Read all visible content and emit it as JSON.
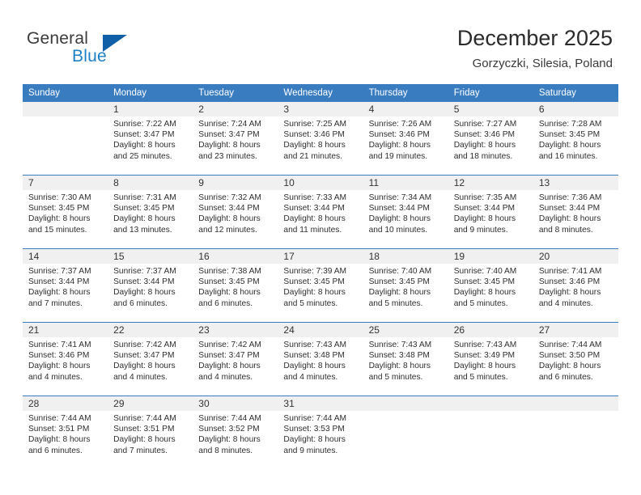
{
  "brand": {
    "name_part1": "General",
    "name_part2": "Blue",
    "triangle_icon": "triangle-icon",
    "accent_color": "#1060a8",
    "blue_text_color": "#1f7fc4"
  },
  "header": {
    "title": "December 2025",
    "subtitle": "Gorzyczki, Silesia, Poland",
    "header_bg_color": "#3a7cc0",
    "header_text_color": "#ffffff"
  },
  "weekday_headers": [
    "Sunday",
    "Monday",
    "Tuesday",
    "Wednesday",
    "Thursday",
    "Friday",
    "Saturday"
  ],
  "weeks": [
    [
      {
        "day": "",
        "sunrise": "",
        "sunset": "",
        "daylight_line1": "",
        "daylight_line2": ""
      },
      {
        "day": "1",
        "sunrise": "Sunrise: 7:22 AM",
        "sunset": "Sunset: 3:47 PM",
        "daylight_line1": "Daylight: 8 hours",
        "daylight_line2": "and 25 minutes."
      },
      {
        "day": "2",
        "sunrise": "Sunrise: 7:24 AM",
        "sunset": "Sunset: 3:47 PM",
        "daylight_line1": "Daylight: 8 hours",
        "daylight_line2": "and 23 minutes."
      },
      {
        "day": "3",
        "sunrise": "Sunrise: 7:25 AM",
        "sunset": "Sunset: 3:46 PM",
        "daylight_line1": "Daylight: 8 hours",
        "daylight_line2": "and 21 minutes."
      },
      {
        "day": "4",
        "sunrise": "Sunrise: 7:26 AM",
        "sunset": "Sunset: 3:46 PM",
        "daylight_line1": "Daylight: 8 hours",
        "daylight_line2": "and 19 minutes."
      },
      {
        "day": "5",
        "sunrise": "Sunrise: 7:27 AM",
        "sunset": "Sunset: 3:46 PM",
        "daylight_line1": "Daylight: 8 hours",
        "daylight_line2": "and 18 minutes."
      },
      {
        "day": "6",
        "sunrise": "Sunrise: 7:28 AM",
        "sunset": "Sunset: 3:45 PM",
        "daylight_line1": "Daylight: 8 hours",
        "daylight_line2": "and 16 minutes."
      }
    ],
    [
      {
        "day": "7",
        "sunrise": "Sunrise: 7:30 AM",
        "sunset": "Sunset: 3:45 PM",
        "daylight_line1": "Daylight: 8 hours",
        "daylight_line2": "and 15 minutes."
      },
      {
        "day": "8",
        "sunrise": "Sunrise: 7:31 AM",
        "sunset": "Sunset: 3:45 PM",
        "daylight_line1": "Daylight: 8 hours",
        "daylight_line2": "and 13 minutes."
      },
      {
        "day": "9",
        "sunrise": "Sunrise: 7:32 AM",
        "sunset": "Sunset: 3:44 PM",
        "daylight_line1": "Daylight: 8 hours",
        "daylight_line2": "and 12 minutes."
      },
      {
        "day": "10",
        "sunrise": "Sunrise: 7:33 AM",
        "sunset": "Sunset: 3:44 PM",
        "daylight_line1": "Daylight: 8 hours",
        "daylight_line2": "and 11 minutes."
      },
      {
        "day": "11",
        "sunrise": "Sunrise: 7:34 AM",
        "sunset": "Sunset: 3:44 PM",
        "daylight_line1": "Daylight: 8 hours",
        "daylight_line2": "and 10 minutes."
      },
      {
        "day": "12",
        "sunrise": "Sunrise: 7:35 AM",
        "sunset": "Sunset: 3:44 PM",
        "daylight_line1": "Daylight: 8 hours",
        "daylight_line2": "and 9 minutes."
      },
      {
        "day": "13",
        "sunrise": "Sunrise: 7:36 AM",
        "sunset": "Sunset: 3:44 PM",
        "daylight_line1": "Daylight: 8 hours",
        "daylight_line2": "and 8 minutes."
      }
    ],
    [
      {
        "day": "14",
        "sunrise": "Sunrise: 7:37 AM",
        "sunset": "Sunset: 3:44 PM",
        "daylight_line1": "Daylight: 8 hours",
        "daylight_line2": "and 7 minutes."
      },
      {
        "day": "15",
        "sunrise": "Sunrise: 7:37 AM",
        "sunset": "Sunset: 3:44 PM",
        "daylight_line1": "Daylight: 8 hours",
        "daylight_line2": "and 6 minutes."
      },
      {
        "day": "16",
        "sunrise": "Sunrise: 7:38 AM",
        "sunset": "Sunset: 3:45 PM",
        "daylight_line1": "Daylight: 8 hours",
        "daylight_line2": "and 6 minutes."
      },
      {
        "day": "17",
        "sunrise": "Sunrise: 7:39 AM",
        "sunset": "Sunset: 3:45 PM",
        "daylight_line1": "Daylight: 8 hours",
        "daylight_line2": "and 5 minutes."
      },
      {
        "day": "18",
        "sunrise": "Sunrise: 7:40 AM",
        "sunset": "Sunset: 3:45 PM",
        "daylight_line1": "Daylight: 8 hours",
        "daylight_line2": "and 5 minutes."
      },
      {
        "day": "19",
        "sunrise": "Sunrise: 7:40 AM",
        "sunset": "Sunset: 3:45 PM",
        "daylight_line1": "Daylight: 8 hours",
        "daylight_line2": "and 5 minutes."
      },
      {
        "day": "20",
        "sunrise": "Sunrise: 7:41 AM",
        "sunset": "Sunset: 3:46 PM",
        "daylight_line1": "Daylight: 8 hours",
        "daylight_line2": "and 4 minutes."
      }
    ],
    [
      {
        "day": "21",
        "sunrise": "Sunrise: 7:41 AM",
        "sunset": "Sunset: 3:46 PM",
        "daylight_line1": "Daylight: 8 hours",
        "daylight_line2": "and 4 minutes."
      },
      {
        "day": "22",
        "sunrise": "Sunrise: 7:42 AM",
        "sunset": "Sunset: 3:47 PM",
        "daylight_line1": "Daylight: 8 hours",
        "daylight_line2": "and 4 minutes."
      },
      {
        "day": "23",
        "sunrise": "Sunrise: 7:42 AM",
        "sunset": "Sunset: 3:47 PM",
        "daylight_line1": "Daylight: 8 hours",
        "daylight_line2": "and 4 minutes."
      },
      {
        "day": "24",
        "sunrise": "Sunrise: 7:43 AM",
        "sunset": "Sunset: 3:48 PM",
        "daylight_line1": "Daylight: 8 hours",
        "daylight_line2": "and 4 minutes."
      },
      {
        "day": "25",
        "sunrise": "Sunrise: 7:43 AM",
        "sunset": "Sunset: 3:48 PM",
        "daylight_line1": "Daylight: 8 hours",
        "daylight_line2": "and 5 minutes."
      },
      {
        "day": "26",
        "sunrise": "Sunrise: 7:43 AM",
        "sunset": "Sunset: 3:49 PM",
        "daylight_line1": "Daylight: 8 hours",
        "daylight_line2": "and 5 minutes."
      },
      {
        "day": "27",
        "sunrise": "Sunrise: 7:44 AM",
        "sunset": "Sunset: 3:50 PM",
        "daylight_line1": "Daylight: 8 hours",
        "daylight_line2": "and 6 minutes."
      }
    ],
    [
      {
        "day": "28",
        "sunrise": "Sunrise: 7:44 AM",
        "sunset": "Sunset: 3:51 PM",
        "daylight_line1": "Daylight: 8 hours",
        "daylight_line2": "and 6 minutes."
      },
      {
        "day": "29",
        "sunrise": "Sunrise: 7:44 AM",
        "sunset": "Sunset: 3:51 PM",
        "daylight_line1": "Daylight: 8 hours",
        "daylight_line2": "and 7 minutes."
      },
      {
        "day": "30",
        "sunrise": "Sunrise: 7:44 AM",
        "sunset": "Sunset: 3:52 PM",
        "daylight_line1": "Daylight: 8 hours",
        "daylight_line2": "and 8 minutes."
      },
      {
        "day": "31",
        "sunrise": "Sunrise: 7:44 AM",
        "sunset": "Sunset: 3:53 PM",
        "daylight_line1": "Daylight: 8 hours",
        "daylight_line2": "and 9 minutes."
      },
      {
        "day": "",
        "sunrise": "",
        "sunset": "",
        "daylight_line1": "",
        "daylight_line2": ""
      },
      {
        "day": "",
        "sunrise": "",
        "sunset": "",
        "daylight_line1": "",
        "daylight_line2": ""
      },
      {
        "day": "",
        "sunrise": "",
        "sunset": "",
        "daylight_line1": "",
        "daylight_line2": ""
      }
    ]
  ]
}
